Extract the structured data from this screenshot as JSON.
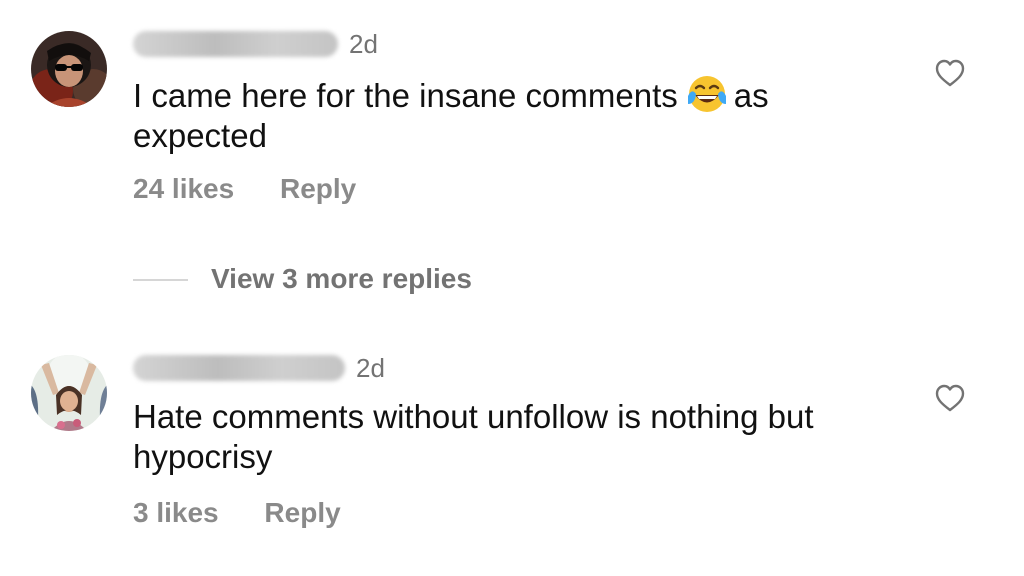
{
  "comments": [
    {
      "username": "sounds_shady",
      "time": "2d",
      "text_before_emoji": "I came here for the insane comments",
      "emoji": "face-with-tears-of-joy",
      "text_after_emoji": "as",
      "text_line2": "expected",
      "likes": "24 likes",
      "reply_label": "Reply",
      "view_replies": "View 3 more replies"
    },
    {
      "username": "mystifying_me",
      "time": "2d",
      "text_line1": "Hate comments without unfollow is nothing but",
      "text_line2": "hypocrisy",
      "likes": "3 likes",
      "reply_label": "Reply"
    }
  ],
  "icons": {
    "like": "heart-outline-icon"
  },
  "colors": {
    "text": "#111111",
    "secondary": "#737373",
    "meta": "#8a8a8a"
  }
}
